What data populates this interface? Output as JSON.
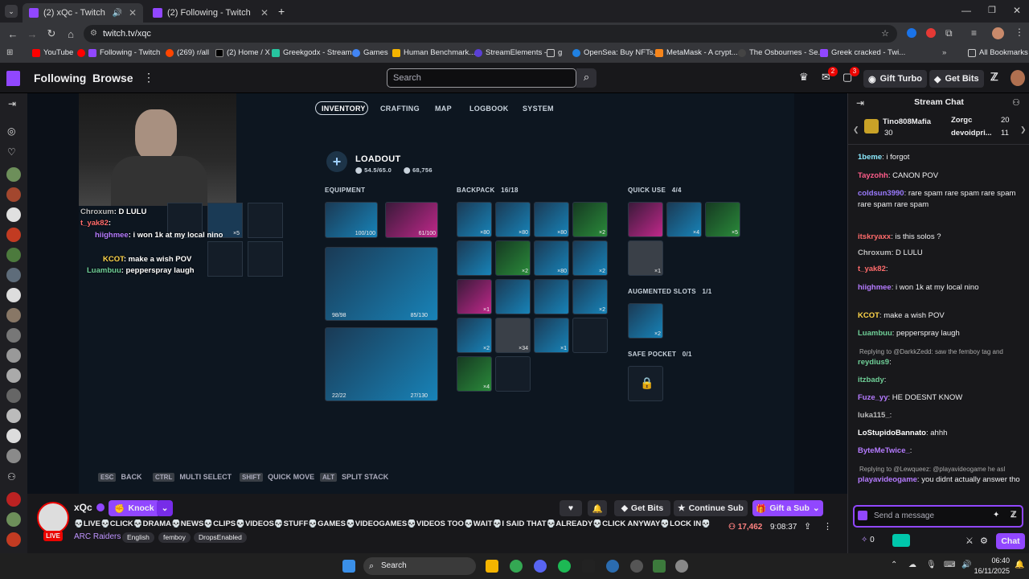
{
  "browser": {
    "tabs": [
      {
        "title": "(2) xQc - Twitch"
      },
      {
        "title": "(2) Following - Twitch"
      }
    ],
    "url": "twitch.tv/xqc",
    "bookmarks": [
      "YouTube",
      "Following - Twitch",
      "(269) r/all",
      "(2) Home / X",
      "Greekgodx - Stream...",
      "Games",
      "Human Benchmark...",
      "StreamElements -",
      "g",
      "OpenSea: Buy NFTs,...",
      "MetaMask - A crypt...",
      "The Osbournes - Se...",
      "Greek cracked - Twi..."
    ],
    "all_bookmarks": "All Bookmarks"
  },
  "twitch": {
    "following": "Following",
    "browse": "Browse",
    "search_placeholder": "Search",
    "notif_badge_1": "2",
    "notif_badge_2": "3",
    "gift_turbo": "Gift Turbo",
    "get_bits": "Get Bits"
  },
  "game": {
    "menu": [
      "INVENTORY",
      "CRAFTING",
      "MAP",
      "LOGBOOK",
      "SYSTEM"
    ],
    "loadout_title": "LOADOUT",
    "weight": "54.5/65.0",
    "money": "68,756",
    "equipment": "EQUIPMENT",
    "backpack": "BACKPACK",
    "backpack_count": "16/18",
    "quick_use": "QUICK USE",
    "quick_use_count": "4/4",
    "augmented": "AUGMENTED SLOTS",
    "augmented_count": "1/1",
    "safe_pocket": "SAFE POCKET",
    "safe_pocket_count": "0/1",
    "equip_vals": [
      "100/100",
      "61/100"
    ],
    "weapon1_ammo": "98/98",
    "weapon1_reserve": "85/130",
    "weapon2_ammo": "22/22",
    "weapon2_reserve": "27/130",
    "bp_qty": [
      "×80",
      "×80",
      "×80",
      "×2",
      "×2",
      "×80",
      "×2",
      "×1",
      "×2",
      "×2",
      "×34",
      "×1",
      "×4"
    ],
    "qu_qty": [
      "×4",
      "×5",
      "×1"
    ],
    "aug_qty": "×2",
    "overlay_qty": "×5",
    "hints": [
      {
        "key": "ESC",
        "label": "BACK"
      },
      {
        "key": "CTRL",
        "label": "MULTI SELECT"
      },
      {
        "key": "SHIFT",
        "label": "QUICK MOVE"
      },
      {
        "key": "ALT",
        "label": "SPLIT STACK"
      }
    ]
  },
  "overlay_chat": [
    {
      "user": "Chroxum",
      "text": ": D LULU"
    },
    {
      "user": "t_yak82",
      "text": ":"
    },
    {
      "user": "hiighmee",
      "text": ": i won 1k at my local nino"
    },
    {
      "user": "KCOT",
      "text": ": make a wish POV"
    },
    {
      "user": "Luambuu",
      "text": ": pepperspray laugh"
    }
  ],
  "stream": {
    "channel": "xQc",
    "knock": "Knock",
    "get_bits": "Get Bits",
    "continue_sub": "Continue Sub",
    "gift_sub": "Gift a Sub",
    "title": "💀LIVE💀CLICK💀DRAMA💀NEWS💀CLIPS💀VIDEOS💀STUFF💀GAMES💀VIDEOGAMES💀VIDEOS TOO💀WAIT💀I SAID THAT💀ALREADY💀CLICK ANYWAY💀LOCK IN💀",
    "category": "ARC Raiders",
    "tags": [
      "English",
      "femboy",
      "DropsEnabled"
    ],
    "viewers": "17,462",
    "uptime": "9:08:37",
    "live": "LIVE"
  },
  "chat": {
    "header": "Stream Chat",
    "gifters": [
      {
        "name": "Tino808Mafia",
        "count": "30"
      },
      {
        "name": "Zorgc",
        "count": "20"
      },
      {
        "name": "devoidpri...",
        "count": "11"
      }
    ],
    "messages": [
      {
        "user": "1beme",
        "color": "#8be9fd",
        "text": "i forgot"
      },
      {
        "user": "Tayzohh",
        "color": "#ff5c8a",
        "text": "CANON POV"
      },
      {
        "user": "coldsun3990",
        "color": "#9b7bff",
        "text": "rare spam rare spam rare spam rare spam rare spam"
      },
      {
        "user": "itskryaxx",
        "color": "#ff6b6b",
        "text": "is this solos ?"
      },
      {
        "user": "Chroxum",
        "color": "#bbbbbb",
        "text": "D LULU"
      },
      {
        "user": "t_yak82",
        "color": "#ff6b6b",
        "text": ""
      },
      {
        "user": "hiighmee",
        "color": "#b57bff",
        "text": "i won 1k at my local nino"
      },
      {
        "user": "KCOT",
        "color": "#ffd54a",
        "text": "make a wish POV"
      },
      {
        "user": "Luambuu",
        "color": "#6fcf97",
        "text": "pepperspray laugh"
      },
      {
        "user": "reydius9",
        "color": "#6fcf97",
        "text": ""
      },
      {
        "user": "itzbady",
        "color": "#6fcf97",
        "text": ""
      },
      {
        "user": "Fuze_yy",
        "color": "#b57bff",
        "text": "HE DOESNT KNOW"
      },
      {
        "user": "luka115_",
        "color": "#bbbbbb",
        "text": ""
      },
      {
        "user": "LoStupidoBannato",
        "color": "#ffffff",
        "text": "ahhh"
      },
      {
        "user": "ByteMeTwice_",
        "color": "#b57bff",
        "text": ""
      },
      {
        "user": "playavideogame",
        "color": "#b57bff",
        "text": "you didnt actually answer tho"
      }
    ],
    "reply1": "Replying to @DarkkZedd: saw the femboy tag and",
    "reply2": "Replying to @Lewqueez: @playavideogame he asl",
    "input_placeholder": "Send a message",
    "points": "0",
    "chat_button": "Chat"
  },
  "taskbar": {
    "search": "Search",
    "time": "06:40",
    "date": "16/11/2025"
  },
  "colors": {
    "twitch_purple": "#9147ff",
    "live_red": "#eb0400"
  }
}
